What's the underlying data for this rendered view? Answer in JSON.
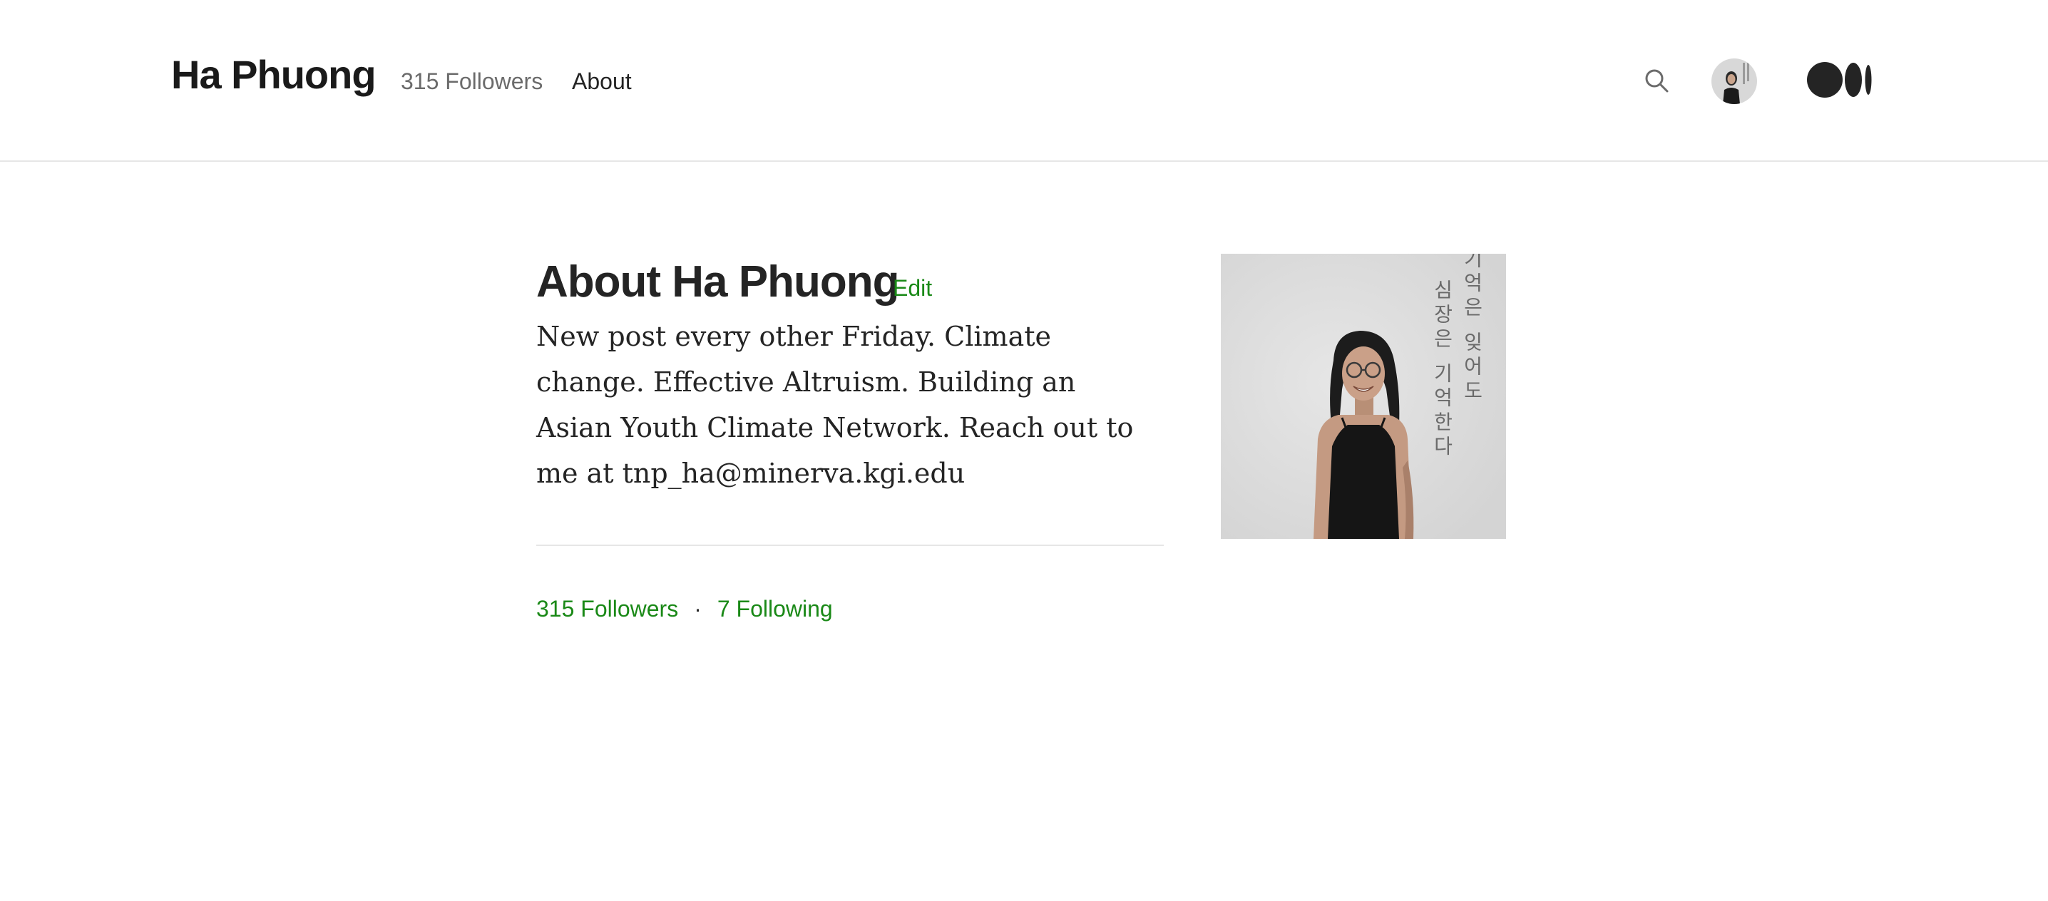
{
  "header": {
    "site_title": "Ha Phuong",
    "followers_link": "315 Followers",
    "about_link": "About",
    "icons": {
      "search": "search-icon",
      "avatar": "user-avatar",
      "logo": "medium-logo-icon"
    }
  },
  "main": {
    "heading": "About Ha Phuong",
    "edit_label": "Edit",
    "bio": "New post every other Friday. Climate change. Effective Altruism. Building an Asian Youth Climate Network. Reach out to me at tnp_ha@minerva.kgi.edu",
    "followers": "315 Followers",
    "separator": "·",
    "following": "7 Following",
    "photo_text_col1": "기억은 잊어도",
    "photo_text_col2": "심장은 기억한다"
  },
  "colors": {
    "accent": "#1a8917",
    "text": "#242424",
    "muted": "#6b6b6b",
    "border": "#e6e6e6"
  }
}
